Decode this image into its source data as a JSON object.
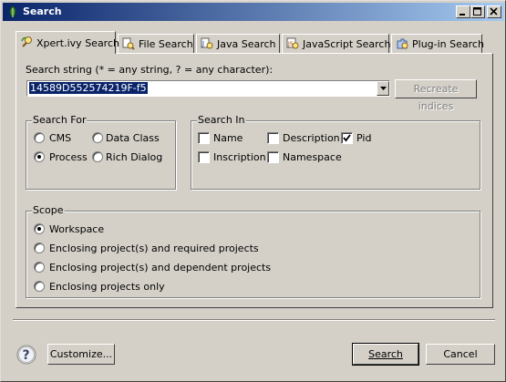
{
  "window": {
    "title": "Search"
  },
  "tabs": [
    {
      "label": "Xpert.ivy Search",
      "icon": "ivy-search-icon",
      "active": true
    },
    {
      "label": "File Search",
      "icon": "file-search-icon"
    },
    {
      "label": "Java Search",
      "icon": "java-search-icon"
    },
    {
      "label": "JavaScript Search",
      "icon": "javascript-search-icon"
    },
    {
      "label": "Plug-in Search",
      "icon": "plugin-search-icon"
    }
  ],
  "search": {
    "label": "Search string (* = any string, ? = any character):",
    "value": "14589D552574219F-f5",
    "recreate_label": "Recreate indices"
  },
  "search_for": {
    "title": "Search For",
    "options": [
      {
        "label": "CMS",
        "checked": false
      },
      {
        "label": "Data Class",
        "checked": false
      },
      {
        "label": "Process",
        "checked": true
      },
      {
        "label": "Rich Dialog",
        "checked": false
      }
    ]
  },
  "search_in": {
    "title": "Search In",
    "options": [
      {
        "label": "Name",
        "checked": false
      },
      {
        "label": "Description",
        "checked": false
      },
      {
        "label": "Pid",
        "checked": true
      },
      {
        "label": "Inscription",
        "checked": false
      },
      {
        "label": "Namespace",
        "checked": false
      }
    ]
  },
  "scope": {
    "title": "Scope",
    "options": [
      {
        "label": "Workspace",
        "checked": true
      },
      {
        "label": "Enclosing project(s) and required projects",
        "checked": false
      },
      {
        "label": "Enclosing project(s) and dependent projects",
        "checked": false
      },
      {
        "label": "Enclosing projects only",
        "checked": false
      }
    ]
  },
  "footer": {
    "customize_label": "Customize...",
    "search_label": "Search",
    "cancel_label": "Cancel"
  },
  "colors": {
    "title_start": "#0a246a",
    "title_end": "#a6caf0",
    "face": "#d4d0c8",
    "selection": "#0a246a"
  }
}
